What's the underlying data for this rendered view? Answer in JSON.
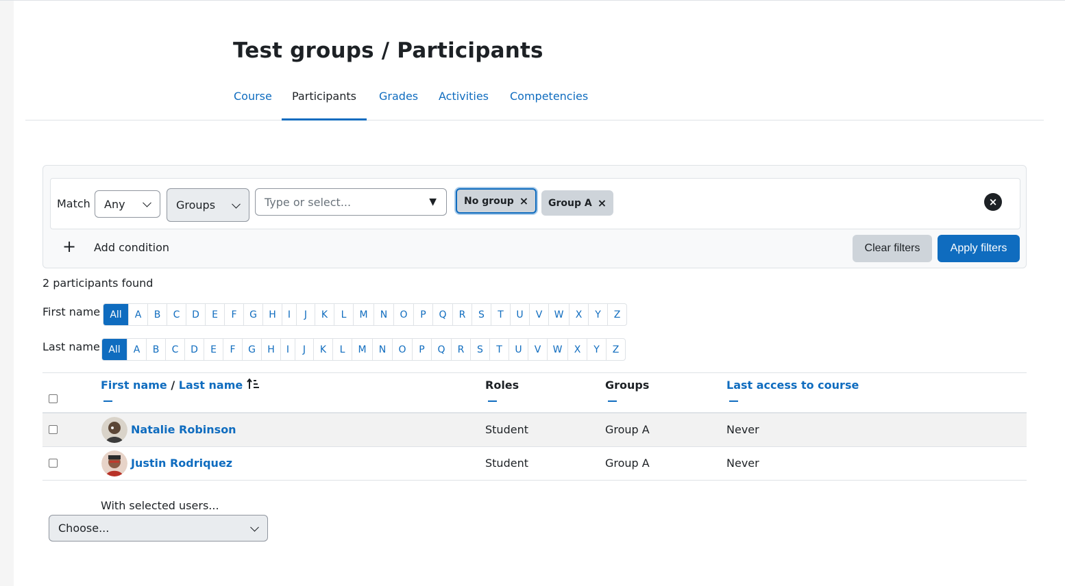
{
  "page": {
    "title": "Test groups / Participants"
  },
  "nav": {
    "tabs": [
      {
        "label": "Course"
      },
      {
        "label": "Participants"
      },
      {
        "label": "Grades"
      },
      {
        "label": "Activities"
      },
      {
        "label": "Competencies"
      }
    ],
    "active_tab": "Participants"
  },
  "filters": {
    "match_label": "Match",
    "match_value": "Any",
    "type_value": "Groups",
    "search_placeholder": "Type or select...",
    "selected": [
      {
        "label": "No group",
        "remove": "×"
      },
      {
        "label": "Group A",
        "remove": "×"
      }
    ],
    "remove_row_icon": "×",
    "add_icon": "+",
    "add_condition_label": "Add condition",
    "clear_label": "Clear filters",
    "apply_label": "Apply filters"
  },
  "results": {
    "count_text": "2 participants found"
  },
  "initials": {
    "first_name_label": "First name",
    "last_name_label": "Last name",
    "letters": [
      "All",
      "A",
      "B",
      "C",
      "D",
      "E",
      "F",
      "G",
      "H",
      "I",
      "J",
      "K",
      "L",
      "M",
      "N",
      "O",
      "P",
      "Q",
      "R",
      "S",
      "T",
      "U",
      "V",
      "W",
      "X",
      "Y",
      "Z"
    ],
    "active": "All"
  },
  "table": {
    "header": {
      "first_name": "First name",
      "separator": "/",
      "last_name": "Last name",
      "sort_icon": "sort-ascending-icon",
      "roles": "Roles",
      "groups": "Groups",
      "last_access": "Last access to course"
    },
    "rows": [
      {
        "name": "Natalie Robinson",
        "role": "Student",
        "group": "Group A",
        "last_access": "Never"
      },
      {
        "name": "Justin Rodriquez",
        "role": "Student",
        "group": "Group A",
        "last_access": "Never"
      }
    ]
  },
  "bulk": {
    "label": "With selected users...",
    "select_value": "Choose..."
  },
  "colors": {
    "primary": "#0f6cbf",
    "text": "#1d2125",
    "border": "#dee2e6",
    "pill": "#ced4da"
  }
}
